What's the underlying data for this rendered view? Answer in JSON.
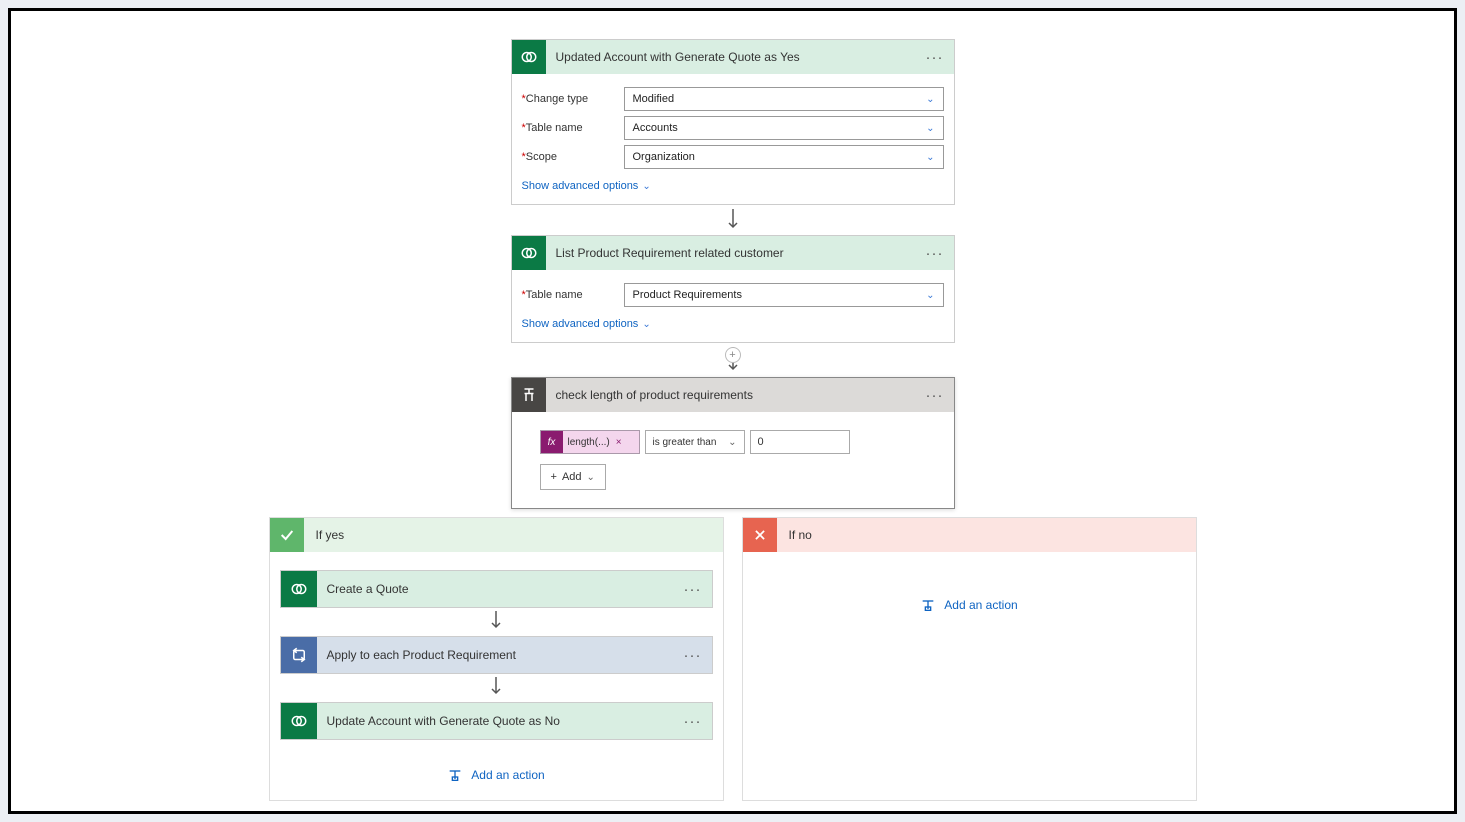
{
  "trigger": {
    "title": "Updated Account with Generate Quote as Yes",
    "fields": [
      {
        "label": "Change type",
        "value": "Modified"
      },
      {
        "label": "Table name",
        "value": "Accounts"
      },
      {
        "label": "Scope",
        "value": "Organization"
      }
    ],
    "advanced": "Show advanced options"
  },
  "list": {
    "title": "List Product Requirement related customer",
    "table_label": "Table name",
    "table_value": "Product Requirements",
    "advanced": "Show advanced options"
  },
  "condition": {
    "title": "check length of product requirements",
    "expr": "length(...)",
    "operator": "is greater than",
    "value": "0",
    "add": "Add"
  },
  "yes": {
    "title": "If yes",
    "actions": [
      {
        "label": "Create a Quote",
        "type": "green"
      },
      {
        "label": "Apply to each Product Requirement",
        "type": "blue"
      },
      {
        "label": "Update Account with Generate Quote as No",
        "type": "green"
      }
    ],
    "add_action": "Add an action"
  },
  "no": {
    "title": "If no",
    "add_action": "Add an action"
  }
}
